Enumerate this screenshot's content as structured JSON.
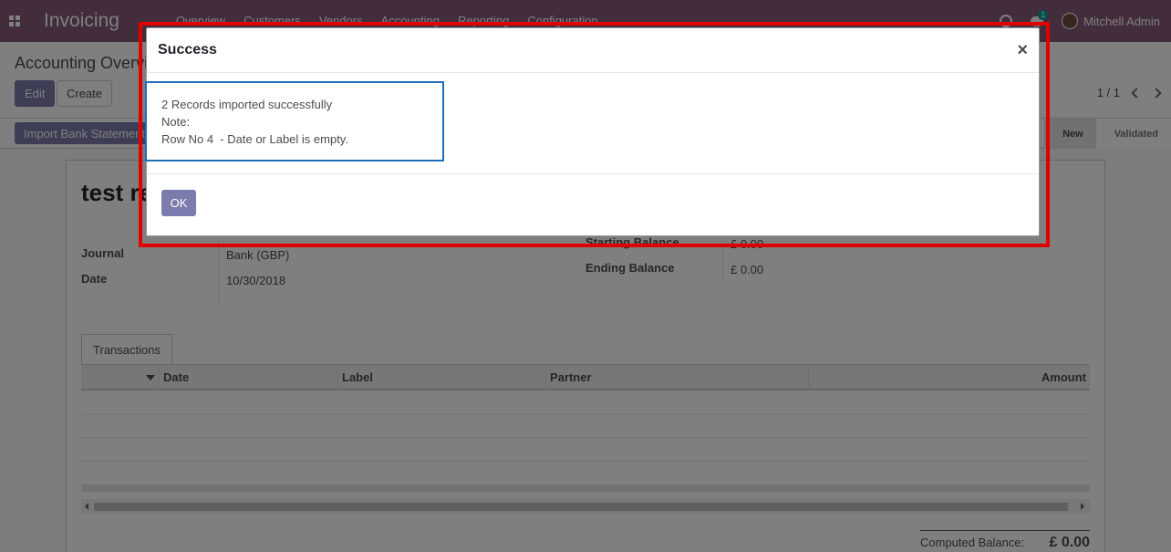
{
  "navbar": {
    "app_title": "Invoicing",
    "menu": [
      "Overview",
      "Customers",
      "Vendors",
      "Accounting",
      "Reporting",
      "Configuration"
    ],
    "chat_count": "1",
    "user_name": "Mitchell Admin"
  },
  "control_panel": {
    "breadcrumb": "Accounting Overview",
    "edit_label": "Edit",
    "create_label": "Create",
    "pager": "1 / 1"
  },
  "statusbar": {
    "import_label": "Import Bank Statement",
    "stages": [
      "New",
      "Validated"
    ],
    "active_stage": "New"
  },
  "form": {
    "title": "test re",
    "journal_label": "Journal",
    "journal_value": "Bank (GBP)",
    "date_label": "Date",
    "date_value": "10/30/2018",
    "starting_balance_label": "Starting Balance",
    "starting_balance_value": "£ 0.00",
    "ending_balance_label": "Ending Balance",
    "ending_balance_value": "£ 0.00",
    "tab_label": "Transactions",
    "columns": [
      "Date",
      "Label",
      "Partner",
      "Amount"
    ],
    "computed_label": "Computed Balance:",
    "computed_value": "£ 0.00"
  },
  "dialog": {
    "title": "Success",
    "close_glyph": "×",
    "message_line1": "2 Records imported successfully",
    "message_line2": "Note:",
    "message_line3": "Row No 4  - Date or Label is empty.",
    "ok_label": "OK"
  },
  "colors": {
    "navbar": "#875a7b",
    "primary_button": "#7c7bad",
    "highlight_frame": "#e00000",
    "message_border": "#1f6fbf"
  }
}
